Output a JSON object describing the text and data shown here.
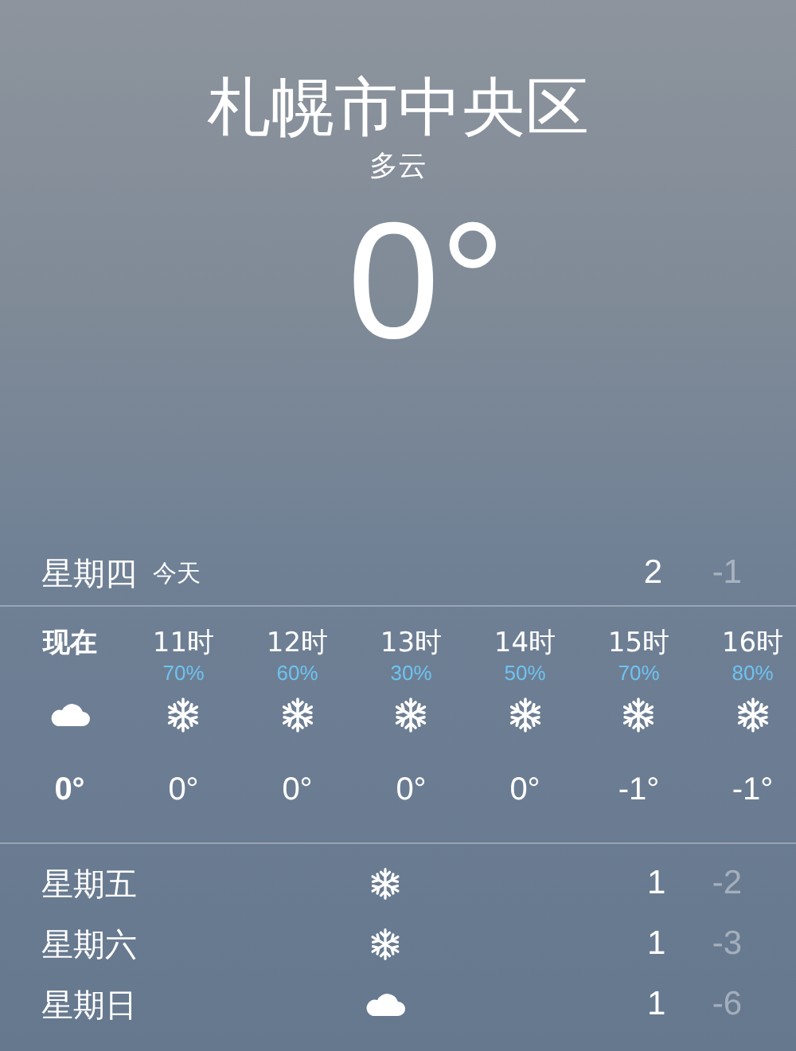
{
  "location": {
    "city": "札幌市中央区",
    "condition": "多云",
    "temperature": "0°"
  },
  "today": {
    "day": "星期四",
    "label": "今天",
    "high": "2",
    "low": "-1"
  },
  "hourly": [
    {
      "time": "现在",
      "selected": true,
      "kind": "cloud",
      "temp": "0°"
    },
    {
      "time": "11时",
      "selected": false,
      "precip": "70%",
      "kind": "snow",
      "temp": "0°"
    },
    {
      "time": "12时",
      "selected": false,
      "precip": "60%",
      "kind": "snow",
      "temp": "0°"
    },
    {
      "time": "13时",
      "selected": false,
      "precip": "30%",
      "kind": "snow",
      "temp": "0°"
    },
    {
      "time": "14时",
      "selected": false,
      "precip": "50%",
      "kind": "snow",
      "temp": "0°"
    },
    {
      "time": "15时",
      "selected": false,
      "precip": "70%",
      "kind": "snow",
      "temp": "-1°"
    },
    {
      "time": "16时",
      "selected": false,
      "precip": "80%",
      "kind": "snow",
      "temp": "-1°"
    }
  ],
  "daily": [
    {
      "day": "星期五",
      "kind": "snow",
      "high": "1",
      "low": "-2"
    },
    {
      "day": "星期六",
      "kind": "snow",
      "high": "1",
      "low": "-3"
    },
    {
      "day": "星期日",
      "kind": "cloud",
      "high": "1",
      "low": "-6"
    }
  ]
}
